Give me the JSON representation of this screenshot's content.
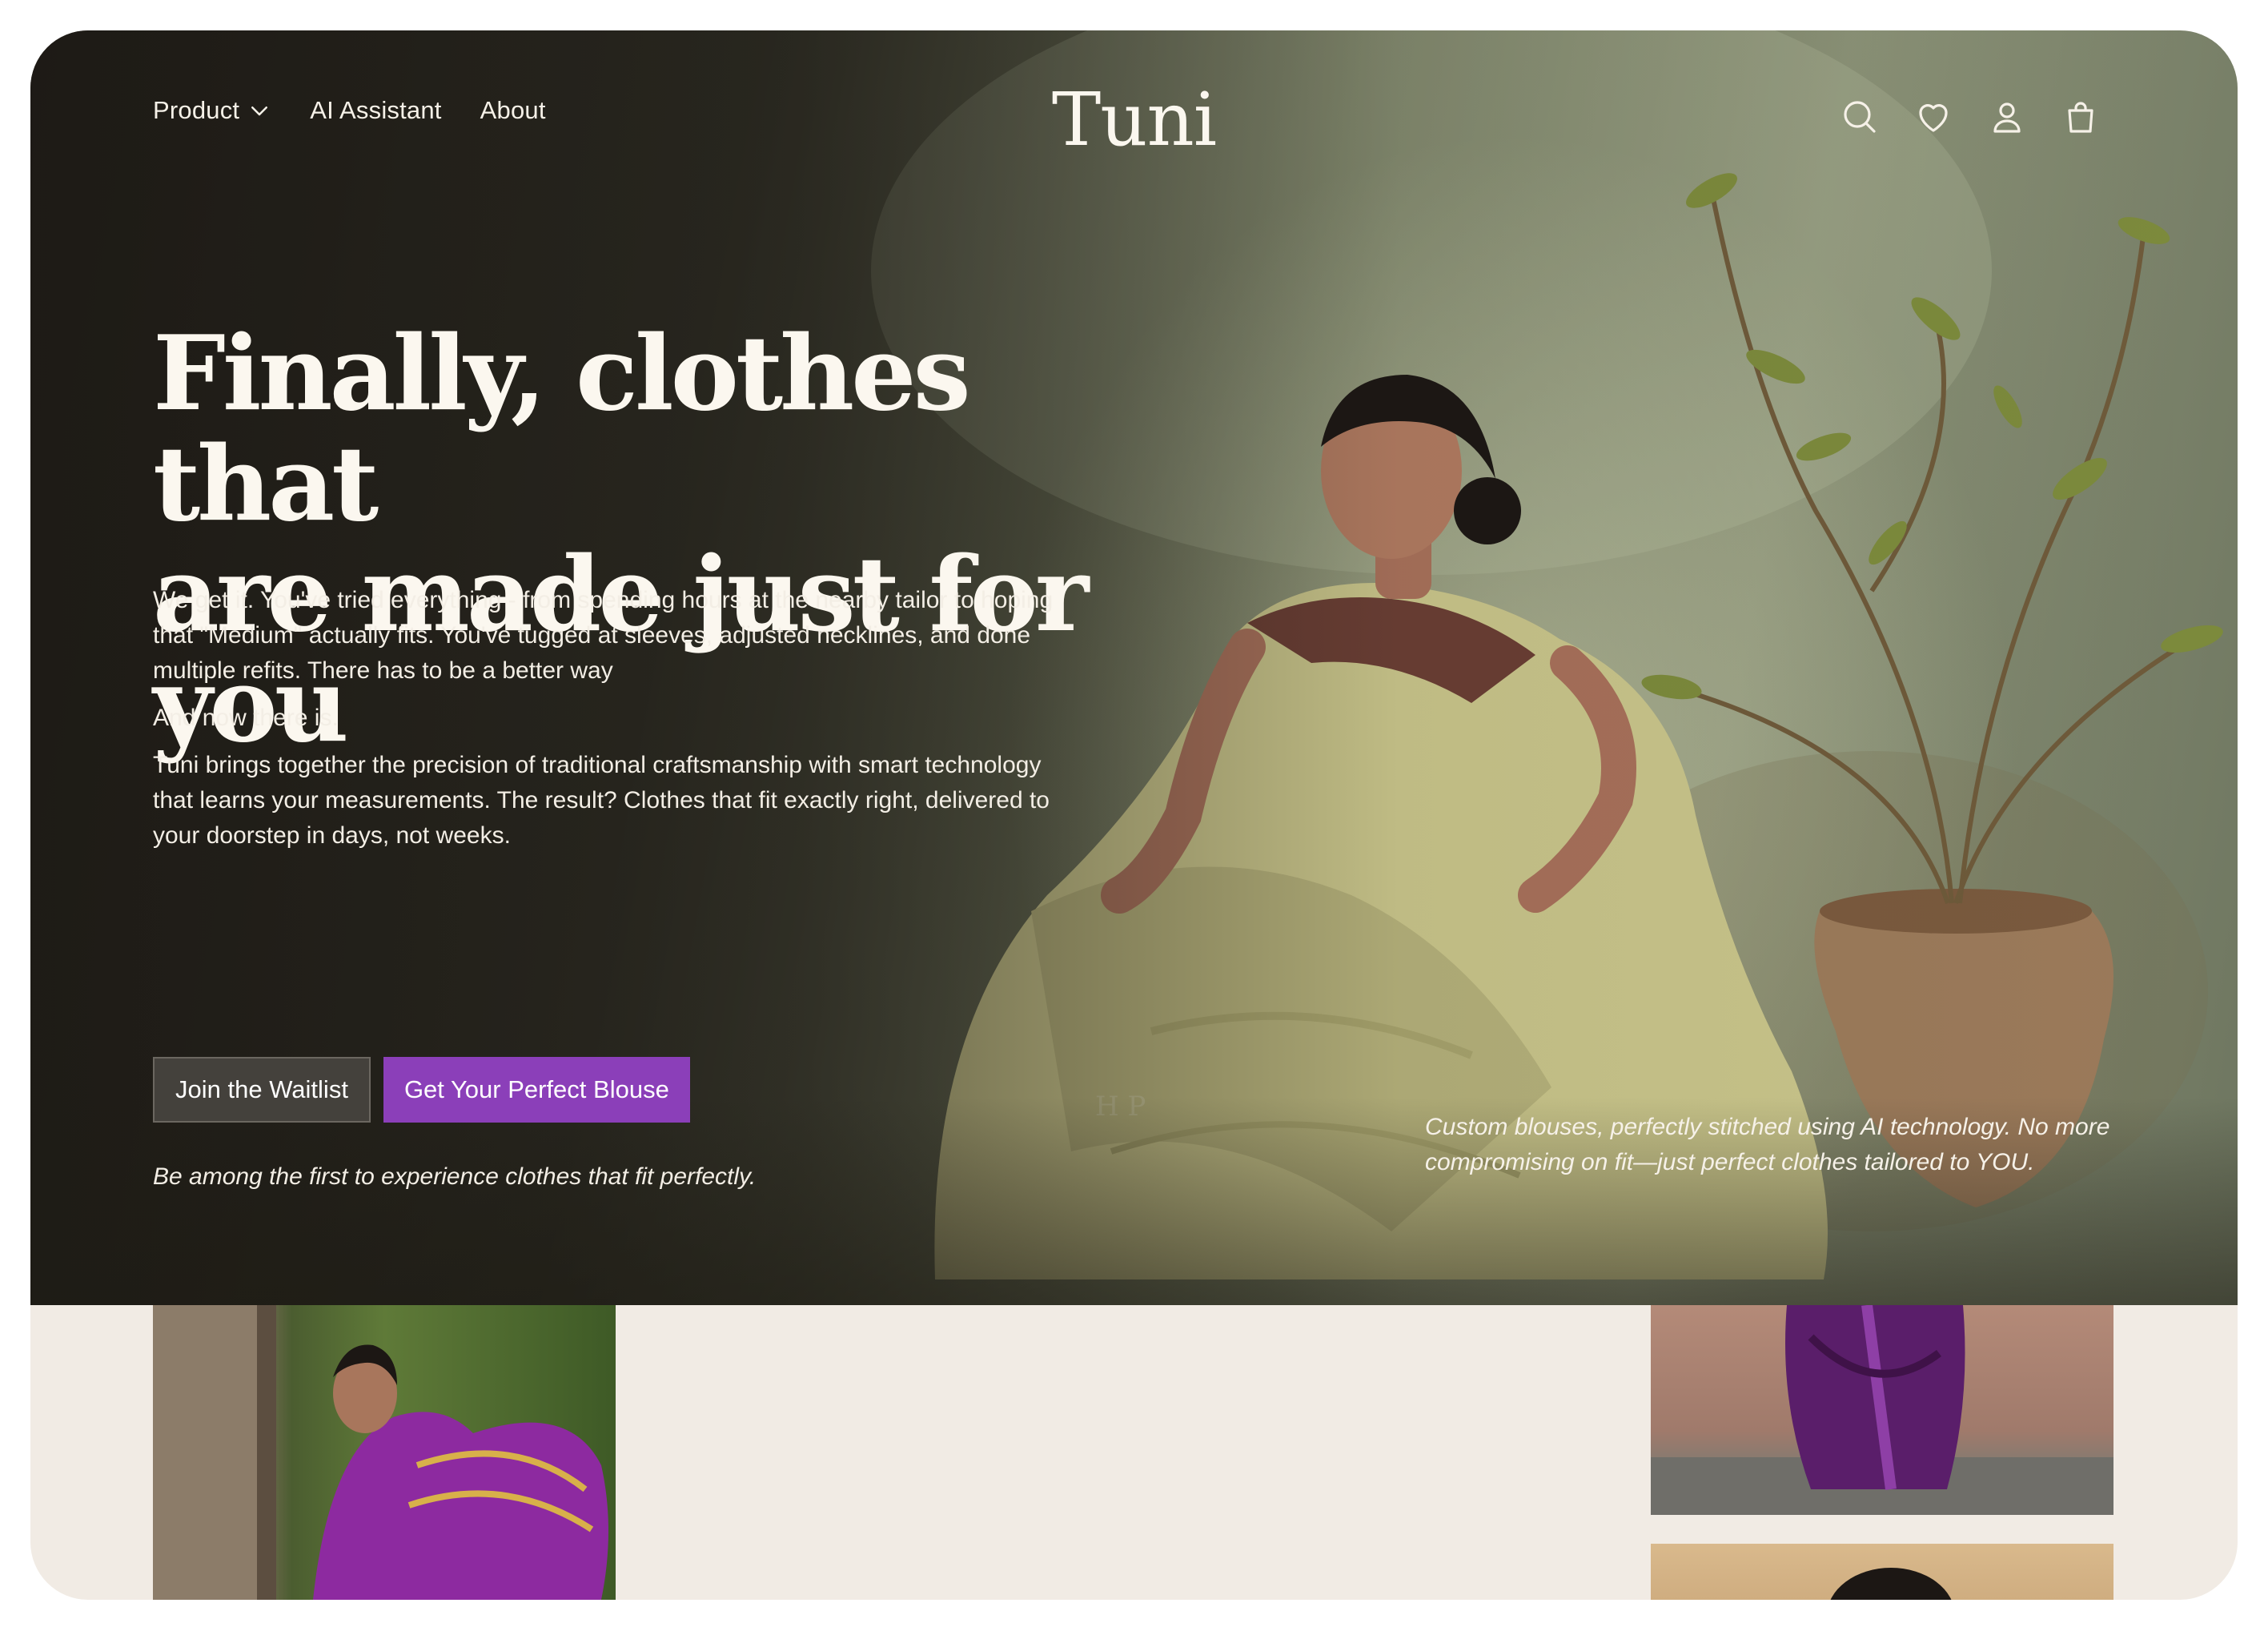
{
  "nav": {
    "product": "Product",
    "ai_assistant": "AI Assistant",
    "about": "About",
    "logo": "Tuni",
    "icons": [
      "search-icon",
      "heart-icon",
      "user-icon",
      "shopping-bag-icon"
    ]
  },
  "hero": {
    "headline_line1": "Finally, clothes that",
    "headline_line2": "are made just for you",
    "para1": "We get it. You've tried everything - from spending hours at the nearby tailor to hoping that \"Medium\" actually fits. You've tugged at sleeves, adjusted necklines, and done multiple refits. There has to be a better way",
    "para2": "And now there is.",
    "para3": "Tuni brings together the precision of traditional craftsmanship with smart technology that learns your measurements. The result? Clothes that fit exactly right, delivered to your doorstep in days, not weeks.",
    "cta_secondary": "Join the Waitlist",
    "cta_primary": "Get Your Perfect Blouse",
    "tagline_left": "Be among the first to experience clothes that fit perfectly.",
    "tagline_right": "Custom blouses, perfectly stitched using AI technology. No more compromising on fit—just perfect clothes tailored to YOU."
  },
  "colors": {
    "accent": "#8b3fb9",
    "secondary_button": "#44413c",
    "page_background": "#f1ebe4",
    "hero_text": "#fbf7ef"
  }
}
